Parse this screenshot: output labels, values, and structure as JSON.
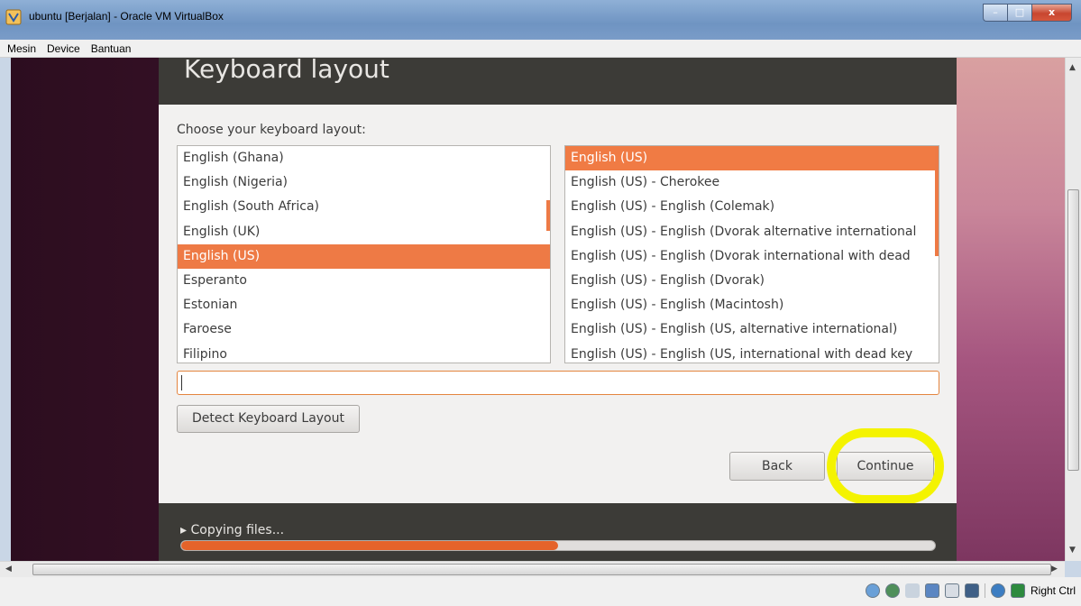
{
  "window": {
    "title": "ubuntu [Berjalan] - Oracle VM VirtualBox",
    "controls": {
      "minimize": "–",
      "maximize": "□",
      "close": "x"
    }
  },
  "menubar": {
    "items": [
      "Mesin",
      "Device",
      "Bantuan"
    ]
  },
  "installer": {
    "heading": "Keyboard layout",
    "prompt": "Choose your keyboard layout:",
    "layouts": [
      "English (Ghana)",
      "English (Nigeria)",
      "English (South Africa)",
      "English (UK)",
      "English (US)",
      "Esperanto",
      "Estonian",
      "Faroese",
      "Filipino"
    ],
    "selected_layout": "English (US)",
    "variants": [
      "English (US)",
      "English (US) - Cherokee",
      "English (US) - English (Colemak)",
      "English (US) - English (Dvorak alternative international",
      "English (US) - English (Dvorak international with dead",
      "English (US) - English (Dvorak)",
      "English (US) - English (Macintosh)",
      "English (US) - English (US, alternative international)",
      "English (US) - English (US, international with dead key"
    ],
    "selected_variant": "English (US)",
    "test_field_value": "",
    "detect_button": "Detect Keyboard Layout",
    "back_button": "Back",
    "continue_button": "Continue",
    "progress_label": "▸ Copying files...",
    "progress_fraction": 0.5
  },
  "statusbar": {
    "host_key": "Right Ctrl"
  },
  "colors": {
    "accent": "#ee7a45",
    "highlight_annotation": "#f4f300",
    "header_bg": "#3c3b37"
  }
}
